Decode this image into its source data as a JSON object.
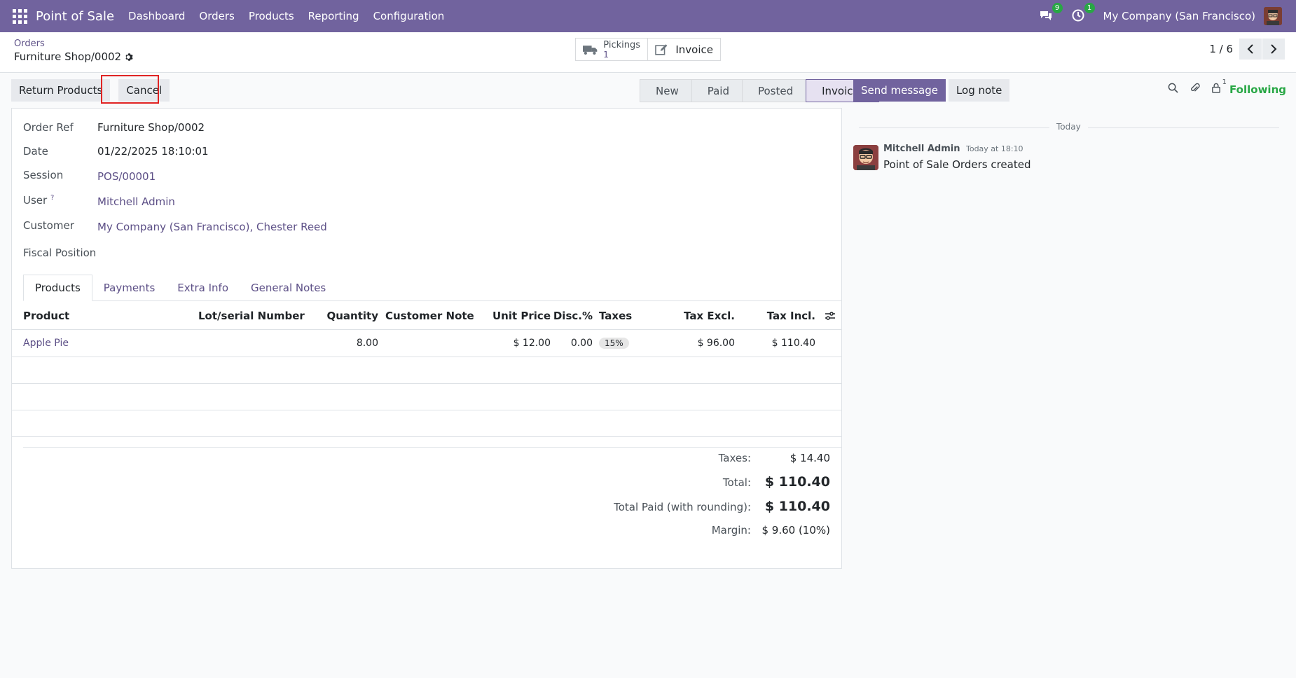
{
  "navbar": {
    "brand": "Point of Sale",
    "menu": [
      "Dashboard",
      "Orders",
      "Products",
      "Reporting",
      "Configuration"
    ],
    "messages_count": "9",
    "activities_count": "1",
    "company": "My Company (San Francisco)"
  },
  "breadcrumb": {
    "parent": "Orders",
    "current": "Furniture Shop/0002"
  },
  "smart_buttons": {
    "pickings_label": "Pickings",
    "pickings_count": "1",
    "invoice_label": "Invoice"
  },
  "pager": {
    "value": "1 / 6"
  },
  "toolbar": {
    "return_label": "Return Products",
    "cancel_label": "Cancel"
  },
  "statusbar": [
    "New",
    "Paid",
    "Posted",
    "Invoiced"
  ],
  "fields": {
    "order_ref_label": "Order Ref",
    "order_ref": "Furniture Shop/0002",
    "date_label": "Date",
    "date": "01/22/2025 18:10:01",
    "session_label": "Session",
    "session": "POS/00001",
    "user_label": "User",
    "user_help": "?",
    "user": "Mitchell Admin",
    "customer_label": "Customer",
    "customer": "My Company (San Francisco), Chester Reed",
    "fiscal_label": "Fiscal Position"
  },
  "tabs": [
    "Products",
    "Payments",
    "Extra Info",
    "General Notes"
  ],
  "table": {
    "headers": {
      "product": "Product",
      "lot": "Lot/serial Number",
      "qty": "Quantity",
      "note": "Customer Note",
      "price": "Unit Price",
      "disc": "Disc.%",
      "taxes": "Taxes",
      "excl": "Tax Excl.",
      "incl": "Tax Incl."
    },
    "rows": [
      {
        "product": "Apple Pie",
        "qty": "8.00",
        "price": "$ 12.00",
        "disc": "0.00",
        "tax": "15%",
        "excl": "$ 96.00",
        "incl": "$ 110.40"
      }
    ]
  },
  "totals": {
    "taxes_label": "Taxes:",
    "taxes": "$ 14.40",
    "total_label": "Total:",
    "total": "$ 110.40",
    "paid_label": "Total Paid (with rounding):",
    "paid": "$ 110.40",
    "margin_label": "Margin:",
    "margin": "$ 9.60 (10%)"
  },
  "chatter": {
    "send_label": "Send message",
    "log_label": "Log note",
    "followers_count": "1",
    "following_label": "Following",
    "date_separator": "Today",
    "message": {
      "author": "Mitchell Admin",
      "time": "Today at 18:10",
      "body": "Point of Sale Orders created"
    }
  },
  "colors": {
    "brand": "#71639e",
    "link": "#5d5087",
    "following": "#28a745",
    "highlight": "#e02424"
  }
}
